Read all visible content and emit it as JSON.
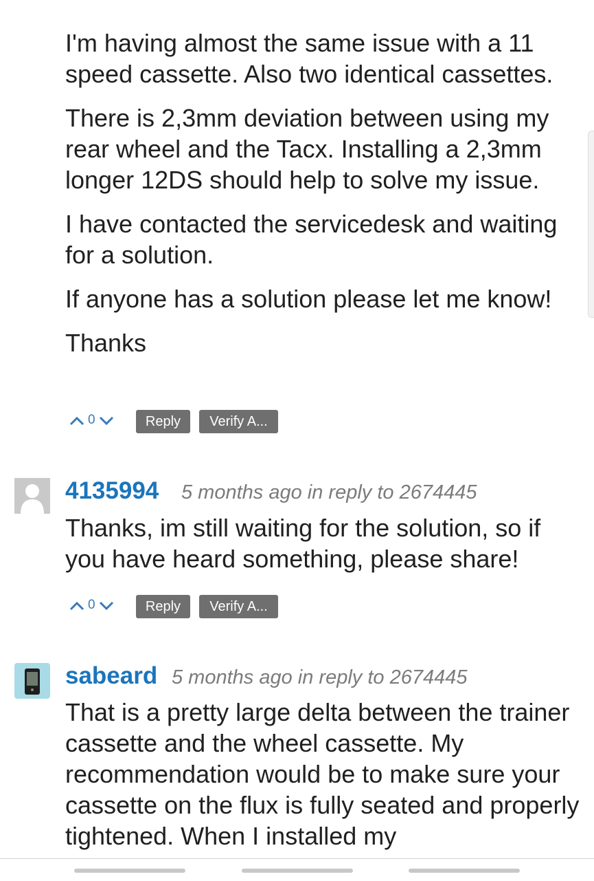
{
  "comment1": {
    "paragraphs": [
      "I'm having almost the same issue with a 11 speed cassette. Also two identical cassettes.",
      "There is 2,3mm deviation between using my rear wheel and the Tacx. Installing a 2,3mm longer 12DS should help to solve my issue.",
      "I have contacted the servicedesk and waiting for a solution.",
      "If anyone has a solution please let me know!",
      "Thanks"
    ],
    "votes": "0",
    "reply_label": "Reply",
    "verify_label": "Verify A..."
  },
  "comment2": {
    "author": "4135994",
    "meta": "5 months ago in reply to 2674445",
    "text": "Thanks, im still waiting for the solution, so if you have heard something, please share!",
    "votes": "0",
    "reply_label": "Reply",
    "verify_label": "Verify A..."
  },
  "comment3": {
    "author": "sabeard",
    "meta": "5 months ago in reply to 2674445",
    "text": "That is a pretty large delta between the trainer cassette and the wheel cassette.  My recommendation would be to make sure your cassette on the flux is fully seated and properly tightened.  When I installed my"
  },
  "colors": {
    "author": "#1b75bb",
    "button_bg": "#6f6f6f",
    "meta": "#7b7b7b",
    "vote": "#3a7ab8"
  },
  "icons": [
    "chevron-up-icon",
    "chevron-down-icon",
    "default-avatar-icon",
    "device-avatar-icon"
  ]
}
